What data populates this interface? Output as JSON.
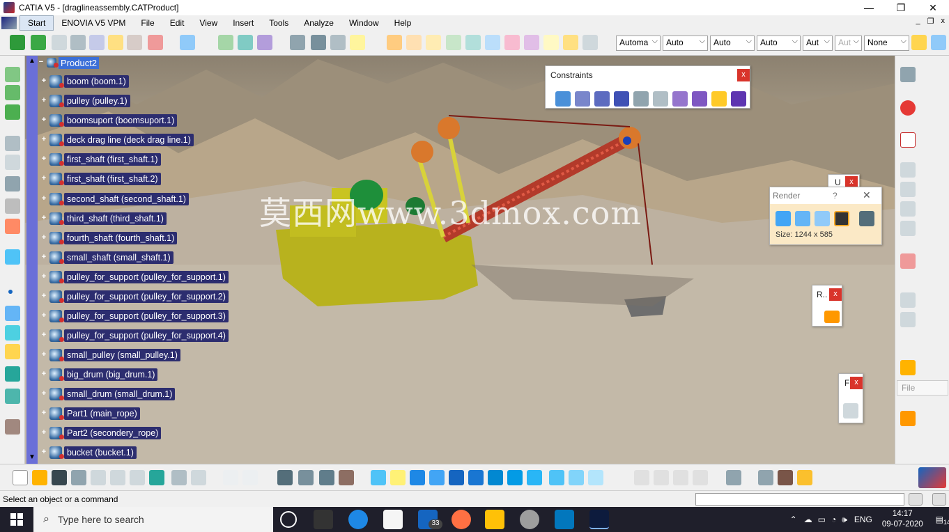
{
  "window": {
    "title": "CATIA V5 - [draglineassembly.CATProduct]",
    "controls": [
      "—",
      "❐",
      "✕"
    ]
  },
  "menu": {
    "items": [
      "Start",
      "ENOVIA V5 VPM",
      "File",
      "Edit",
      "View",
      "Insert",
      "Tools",
      "Analyze",
      "Window",
      "Help"
    ],
    "mdi_controls": [
      "_",
      "❐",
      "x"
    ]
  },
  "toolbar": {
    "combos": [
      "Automa",
      "Auto",
      "Auto",
      "Auto",
      "Aut",
      "Aut",
      "None"
    ]
  },
  "tree": {
    "root": "Product2",
    "items": [
      "boom (boom.1)",
      "pulley (pulley.1)",
      "boomsuport (boomsuport.1)",
      "deck drag line (deck drag line.1)",
      "first_shaft (first_shaft.1)",
      "first_shaft (first_shaft.2)",
      "second_shaft (second_shaft.1)",
      "third_shaft (third_shaft.1)",
      "fourth_shaft (fourth_shaft.1)",
      "small_shaft (small_shaft.1)",
      "pulley_for_support (pulley_for_support.1)",
      "pulley_for_support (pulley_for_support.2)",
      "pulley_for_support (pulley_for_support.3)",
      "pulley_for_support (pulley_for_support.4)",
      "small_pulley (small_pulley.1)",
      "big_drum (big_drum.1)",
      "small_drum (small_drum.1)",
      "Part1 (main_rope)",
      "Part2 (secondery_rope)",
      "bucket (bucket.1)"
    ]
  },
  "panels": {
    "constraints": {
      "title": "Constraints",
      "close": "x"
    },
    "render": {
      "title": "Render",
      "help": "?",
      "close": "✕",
      "size": "Size: 1244 x 585"
    },
    "small_u": {
      "title": "U",
      "close": "x"
    },
    "small_r": {
      "title": "R..",
      "close": "x"
    },
    "small_f": {
      "title": "F",
      "close": "x"
    }
  },
  "right_toolbar": {
    "file_label": "File"
  },
  "watermark": "莫西网www.3dmox.com",
  "status": {
    "message": "Select an object or a command"
  },
  "taskbar": {
    "search_placeholder": "Type here to search",
    "mail_badge": "33",
    "language": "ENG",
    "time": "14:17",
    "date": "09-07-2020",
    "notifications": "14"
  },
  "colors": {
    "tree_label_bg": "#2c2d6f",
    "root_highlight": "#3b6fd8",
    "scroll": "#6a6fd8",
    "close_red": "#d9342b"
  }
}
